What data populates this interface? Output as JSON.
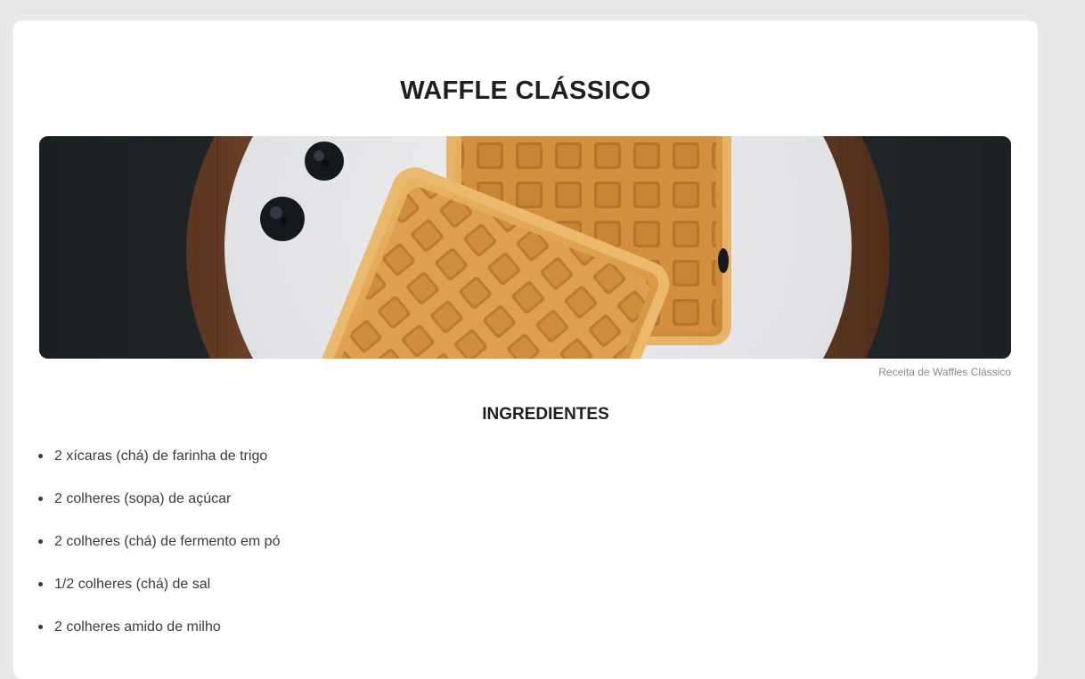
{
  "recipe": {
    "title": "WAFFLE CLÁSSICO",
    "image_caption": "Receita de Waffles Clássico",
    "ingredients_heading": "INGREDIENTES",
    "ingredients": [
      "2 xícaras (chá) de farinha de trigo",
      "2 colheres (sopa) de açúcar",
      "2 colheres (chá) de fermento em pó",
      "1/2 colheres (chá) de sal",
      "2 colheres amido de milho"
    ]
  },
  "colors": {
    "page_background": "#e8e8e8",
    "card_background": "#ffffff",
    "heading_text": "#1f1f1f",
    "body_text": "#3a3a3a",
    "caption_text": "#8a8a8a"
  }
}
